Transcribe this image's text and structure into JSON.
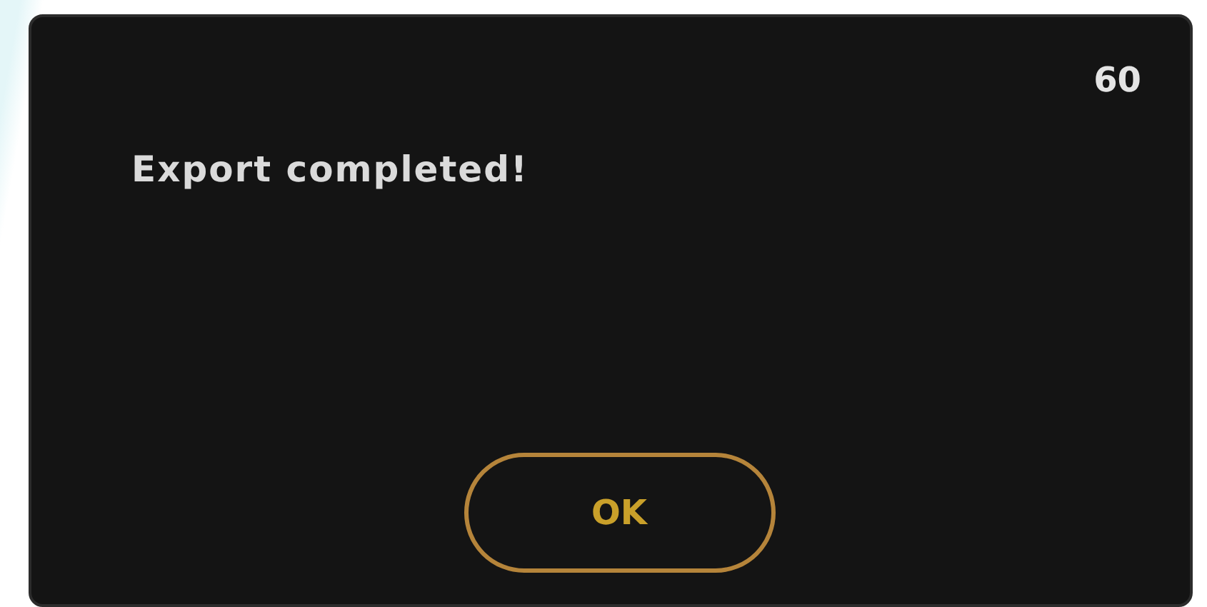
{
  "dialog": {
    "counter": "60",
    "message": "Export completed!",
    "buttons": [
      "OK"
    ]
  }
}
